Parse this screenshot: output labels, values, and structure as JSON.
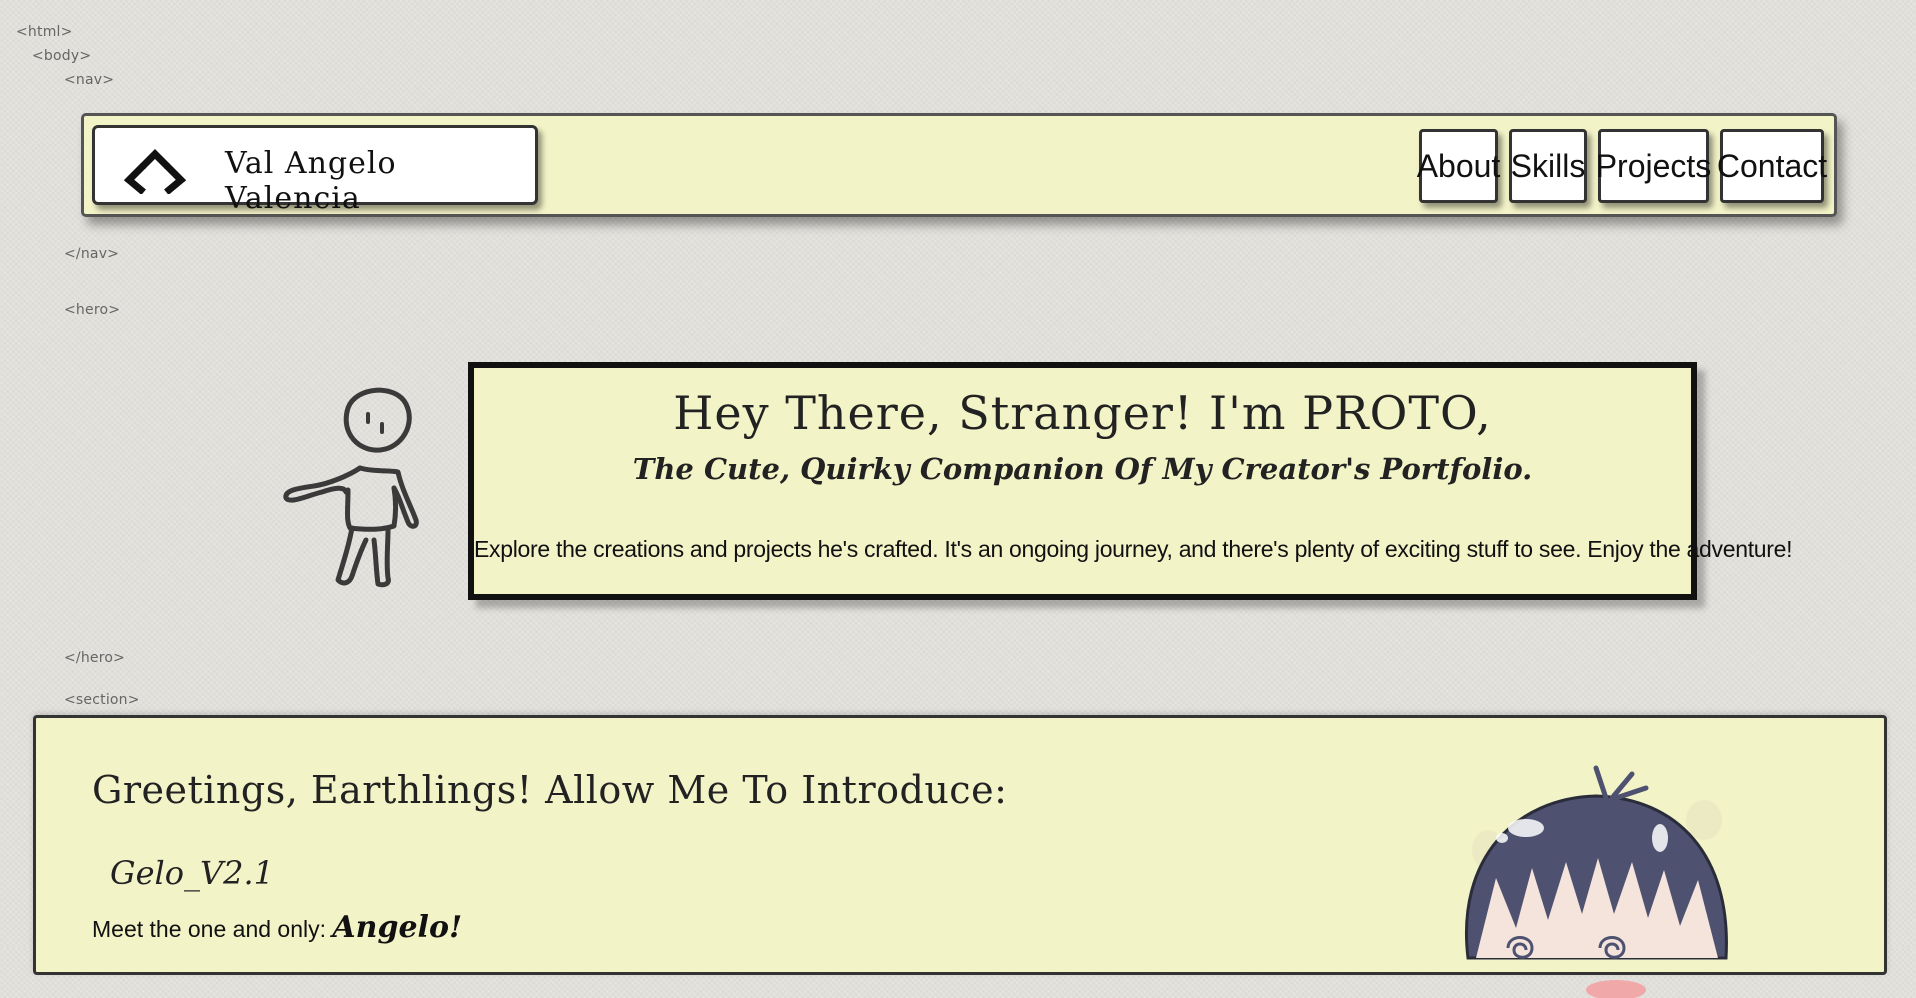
{
  "code_tags": {
    "html_open": "<html>",
    "body_open": "<body>",
    "nav_open": "<nav>",
    "nav_close": "</nav>",
    "hero_open": "<hero>",
    "hero_close": "</hero>",
    "section_open": "<section>"
  },
  "nav": {
    "brand_name": "Val Angelo Valencia",
    "logo_icon": "code-chevrons-icon",
    "links": [
      "About",
      "Skills",
      "Projects",
      "Contact"
    ]
  },
  "hero": {
    "title": "Hey There, Stranger! I'm PROTO,",
    "subtitle": "The Cute, Quirky Companion Of My Creator's Portfolio.",
    "description": "Explore the creations and projects he's crafted. It's an ongoing journey, and there's plenty of exciting stuff to see. Enjoy the adventure!",
    "mascot_icon": "stick-figure-icon"
  },
  "about": {
    "heading": "Greetings, Earthlings! Allow Me To Introduce:",
    "version": "Gelo_V2.1",
    "meet_prefix": "Meet the one and only:",
    "meet_name": "Angelo!",
    "avatar_icon": "anime-avatar-icon"
  },
  "colors": {
    "panel": "#f3f3c8",
    "background": "#e4e2dd",
    "ink": "#222222",
    "avatar_hair": "#4e5270"
  }
}
